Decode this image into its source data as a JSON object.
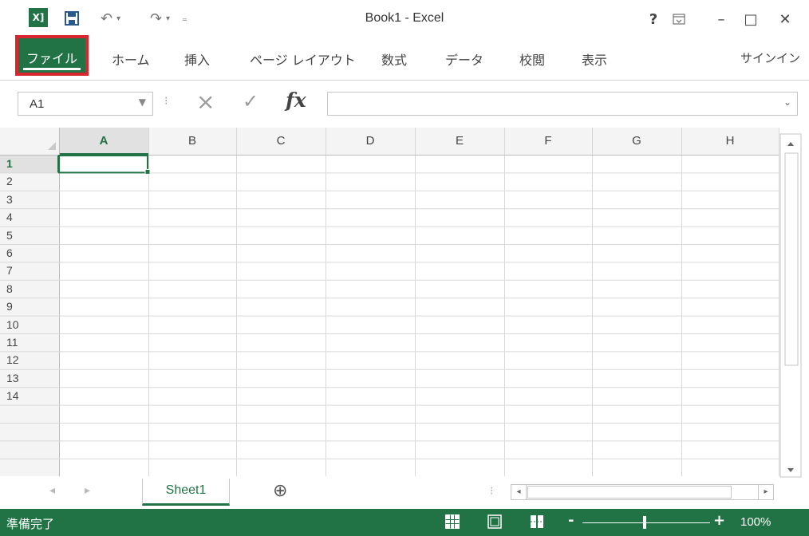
{
  "window": {
    "title": "Book1 - Excel",
    "help_label": "?",
    "minimize_label": "–",
    "maximize_label": "□",
    "close_label": "✕"
  },
  "ribbon": {
    "tabs": [
      "ファイル",
      "ホーム",
      "挿入",
      "ページ レイアウト",
      "数式",
      "データ",
      "校閲",
      "表示"
    ],
    "signin_label": "サインイン"
  },
  "formula_bar": {
    "name_box_value": "A1",
    "cancel_icon": "×",
    "enter_icon": "✓",
    "function_label": "fx",
    "formula_value": ""
  },
  "grid": {
    "columns": [
      "A",
      "B",
      "C",
      "D",
      "E",
      "F",
      "G",
      "H"
    ],
    "rows": [
      "1",
      "2",
      "3",
      "4",
      "5",
      "6",
      "7",
      "8",
      "9",
      "10",
      "11",
      "12",
      "13",
      "14"
    ],
    "active_cell": "A1"
  },
  "sheets": {
    "tabs": [
      "Sheet1"
    ],
    "add_sheet_label": "⊕"
  },
  "status_bar": {
    "status_text": "準備完了",
    "zoom_level": "100%",
    "zoom_minus": "-",
    "zoom_plus": "+"
  },
  "colors": {
    "accent": "#217346",
    "highlight_box": "#d9252e"
  }
}
